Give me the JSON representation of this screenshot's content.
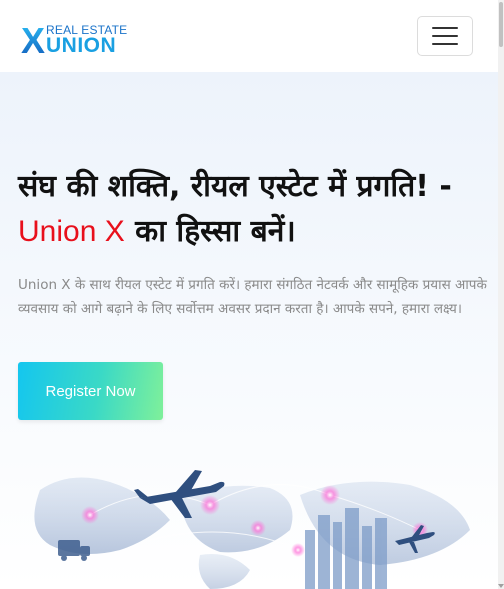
{
  "nav": {
    "logo": {
      "x_letter": "X",
      "top_text": "REAL ESTATE",
      "bottom_text": "UNION"
    },
    "toggle_icon": "hamburger-menu-icon"
  },
  "hero": {
    "title_part1": "संघ की शक्ति, रीयल एस्टेट में प्रगति! - ",
    "title_brand": "Union X",
    "title_part2": " का हिस्सा बनें।",
    "description": "Union X के साथ रीयल एस्टेट में प्रगति करें। हमारा संगठित नेटवर्क और सामूहिक प्रयास आपके व्यवसाय को आगे बढ़ाने के लिए सर्वोत्तम अवसर प्रदान करता है। आपके सपने, हमारा लक्ष्य।",
    "cta_label": "Register Now",
    "illustration": "world-map-airplanes-logistics-illustration"
  },
  "colors": {
    "brand_red": "#e8101c",
    "logo_blue": "#1aa0e2",
    "cta_gradient_start": "#14c6ef",
    "cta_gradient_end": "#7ff09a"
  }
}
